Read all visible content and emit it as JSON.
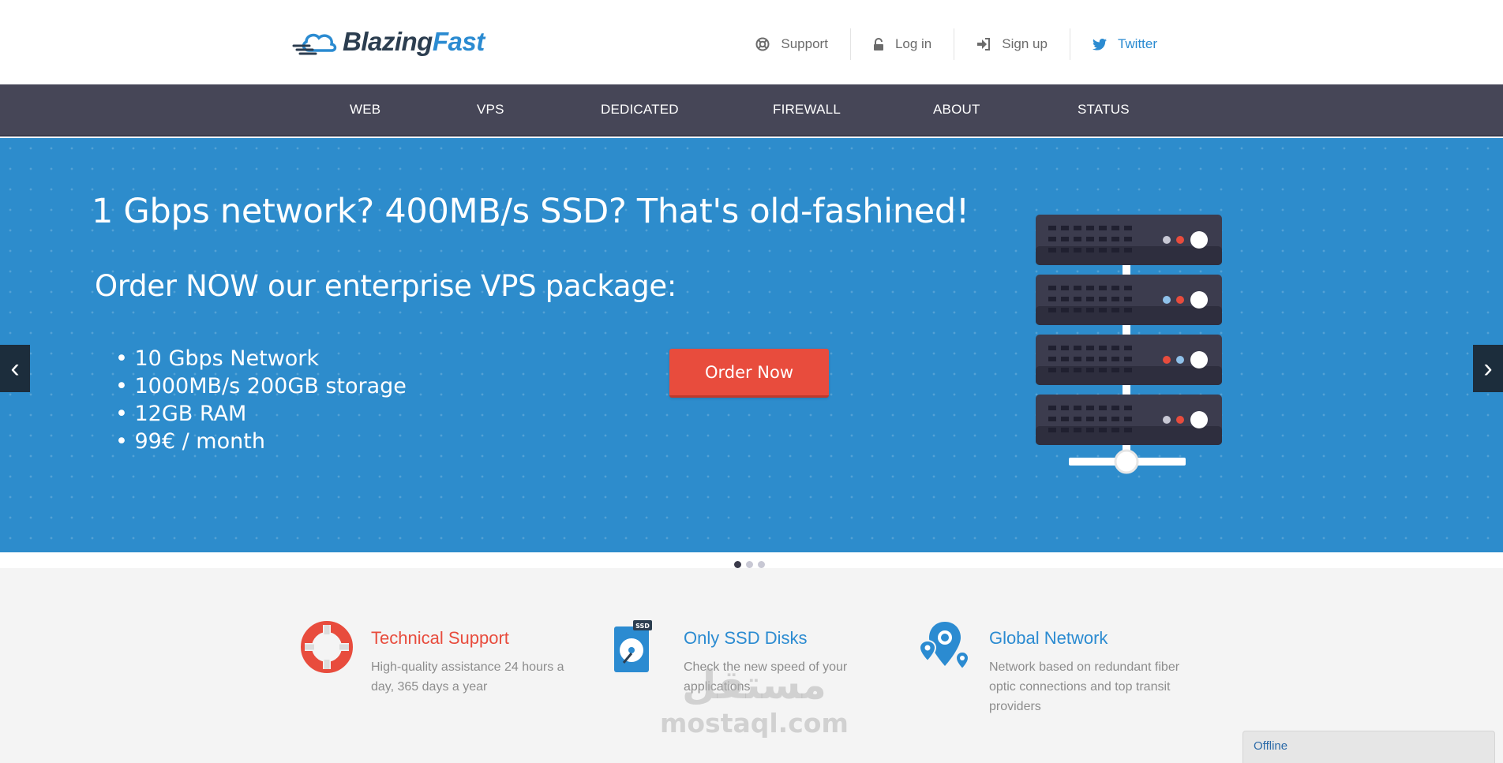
{
  "header": {
    "logo": {
      "word1": "Blazing",
      "word2": "Fast"
    },
    "links": [
      {
        "label": "Support",
        "icon": "lifebuoy-icon"
      },
      {
        "label": "Log in",
        "icon": "lock-icon"
      },
      {
        "label": "Sign up",
        "icon": "sign-in-icon"
      },
      {
        "label": "Twitter",
        "icon": "twitter-icon"
      }
    ]
  },
  "nav": {
    "items": [
      "WEB",
      "VPS",
      "DEDICATED",
      "FIREWALL",
      "ABOUT",
      "STATUS"
    ]
  },
  "hero": {
    "headline": "1 Gbps network? 400MB/s SSD? That's old-fashined!",
    "subheadline": "Order NOW our enterprise VPS package:",
    "features": [
      "• 10 Gbps Network",
      "• 1000MB/s 200GB storage",
      "• 12GB RAM",
      "• 99€ / month"
    ],
    "cta": "Order Now",
    "prev_arrow": "‹",
    "next_arrow": "›"
  },
  "carousel": {
    "slide_count": 3,
    "active_index": 0
  },
  "features": [
    {
      "title": "Technical Support",
      "desc": "High-quality assistance 24 hours a day, 365 days a year",
      "icon": "lifebuoy-icon"
    },
    {
      "title": "Only SSD Disks",
      "desc": "Check the new speed of your applications",
      "icon": "ssd-disk-icon",
      "badge": "SSD"
    },
    {
      "title": "Global Network",
      "desc": "Network based on redundant fiber optic connections and top transit providers",
      "icon": "map-pin-icon"
    }
  ],
  "watermark": {
    "arabic": "مستقل",
    "latin": "mostaql.com"
  },
  "chat": {
    "status": "Offline"
  },
  "colors": {
    "brand_dark": "#2c3e50",
    "brand_blue": "#2b8bd1",
    "nav_bg": "#464657",
    "hero_bg": "#2d8ccc",
    "cta_red": "#e84c3d",
    "features_bg": "#f4f4f4"
  }
}
